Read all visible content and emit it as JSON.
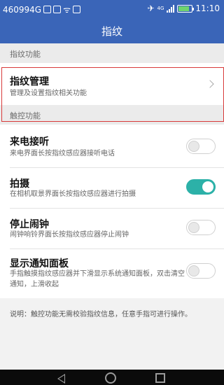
{
  "status_bar": {
    "carrier": "460994G",
    "time": "11:10",
    "network": "4G",
    "battery_color": "#6fd36f"
  },
  "header": {
    "title": "指纹",
    "color": "#3a65b8"
  },
  "sections": {
    "fingerprint": {
      "label": "指纹功能"
    },
    "touch": {
      "label": "触控功能"
    }
  },
  "fingerprint_management": {
    "title": "指纹管理",
    "subtitle": "管理及设置指纹相关功能"
  },
  "settings": [
    {
      "title": "来电接听",
      "subtitle": "来电界面长按指纹感应器接听电话",
      "enabled": false
    },
    {
      "title": "拍摄",
      "subtitle": "在相机取景界面长按指纹感应器进行拍摄",
      "enabled": true
    },
    {
      "title": "停止闹钟",
      "subtitle": "闹钟响铃界面长按指纹感应器停止闹钟",
      "enabled": false
    },
    {
      "title": "显示通知面板",
      "subtitle": "手指触摸指纹感应器并下滑显示系统通知面板，双击清空通知，上滑收起",
      "enabled": false
    }
  ],
  "note": "说明：触控功能无需校验指纹信息，任意手指可进行操作。",
  "colors": {
    "toggle_on": "#2cb1a8",
    "highlight": "#d83a3a"
  }
}
